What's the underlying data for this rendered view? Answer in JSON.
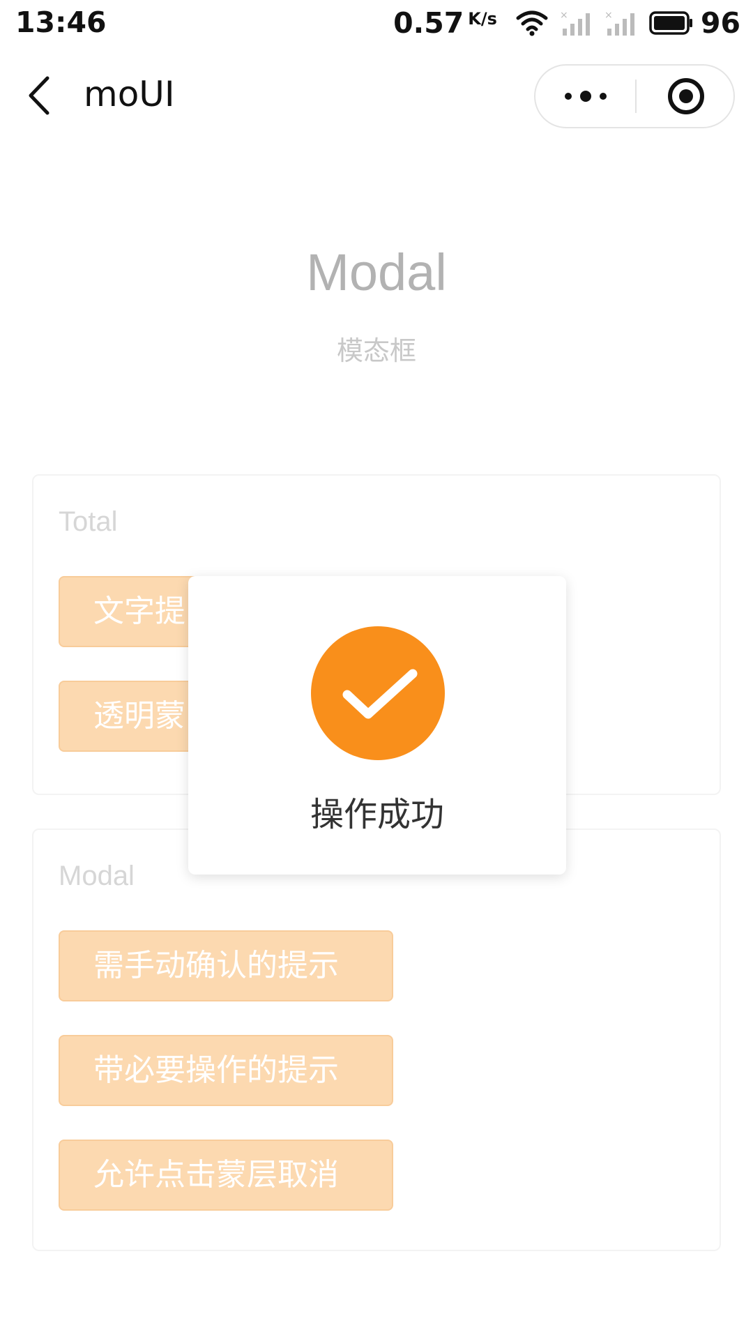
{
  "status_bar": {
    "time": "13:46",
    "net_speed": "0.57",
    "net_unit": "K/s",
    "battery": "96"
  },
  "nav": {
    "title": "moUI",
    "icons": {
      "back": "chevron-left-icon",
      "more": "more-dots-icon",
      "close": "target-circle-icon"
    }
  },
  "header": {
    "title": "Modal",
    "subtitle": "模态框"
  },
  "sections": [
    {
      "label": "Total",
      "buttons": [
        "文字提",
        "透明蒙"
      ]
    },
    {
      "label": "Modal",
      "buttons": [
        "需手动确认的提示",
        "带必要操作的提示",
        "允许点击蒙层取消"
      ]
    }
  ],
  "toast": {
    "text": "操作成功",
    "icon": "checkmark-icon"
  },
  "colors": {
    "accent": "#f98f1b",
    "button_bg": "#fcd9b0",
    "title_gray": "#b2b2b2"
  }
}
